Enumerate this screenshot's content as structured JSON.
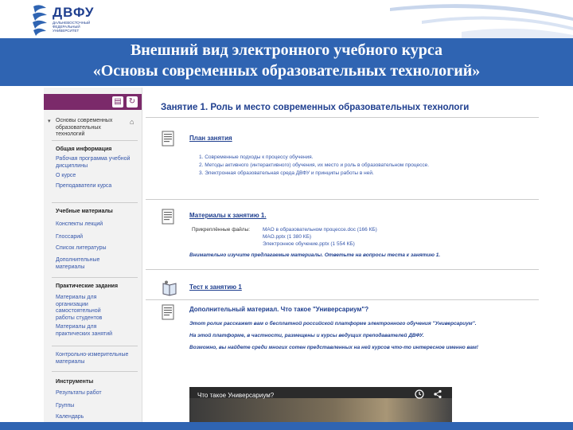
{
  "logo": {
    "text": "ДВФУ",
    "sub": "ДАЛЬНЕВОСТОЧНЫЙ ФЕДЕРАЛЬНЫЙ УНИВЕРСИТЕТ"
  },
  "slide": {
    "title_line1": "Внешний вид электронного учебного курса",
    "title_line2": "«Основы современных образовательных технологий»"
  },
  "sidebar": {
    "course_title": "Основы современных образовательных технологий",
    "sections": [
      {
        "title": "Общая информация",
        "items": [
          "Рабочая программа учебной дисциплины",
          "О курсе",
          "Преподаватели курса"
        ]
      },
      {
        "title": "Учебные материалы",
        "items": [
          "Конспекты лекций",
          "Глоссарий",
          "Список литературы",
          "Дополнительные материалы"
        ]
      },
      {
        "title": "Практические задания",
        "items": [
          "Материалы для организации самостоятельной работы студентов",
          "Материалы для практических занятий"
        ]
      },
      {
        "title": "",
        "items": [
          "Контрольно-измерительные материалы"
        ]
      },
      {
        "title": "Инструменты",
        "items": [
          "Результаты работ",
          "Группы",
          "Календарь"
        ]
      }
    ]
  },
  "main": {
    "title": "Занятие 1. Роль и место современных образовательных технологи",
    "blocks": [
      {
        "title": "План занятия",
        "lines": [
          "1.  Современные подходы к процессу обучения.",
          "2.  Методы активного (интерактивного) обучения, их место и роль в образовательном процессе.",
          "3.  Электронная образовательная среда ДВФУ и принципы работы в ней."
        ]
      },
      {
        "title": "Материалы к занятию 1.",
        "label": "Прикреплённые файлы:",
        "files": [
          "МАО в образовательном процессе.doc (166 КБ)",
          "МАО.pptx (1 380 КБ)",
          "Электронное обучение.pptx (1 554 КБ)"
        ],
        "note": "Внимательно изучите предлагаемые материалы. Ответьте на вопросы теста к занятию 1."
      },
      {
        "title": "Тест к занятию 1"
      },
      {
        "title": "Дополнительный материал. Что такое \"Универсариум\"?",
        "notes": [
          "Этот ролик расскажет вам о бесплатной российской платформе электронного обучения \"Универсариум\".",
          "На этой платформе, в частности, размещены и курсы ведущих преподавателей ДВФУ.",
          "Возможно, вы найдете среди многих сотен представленных на ней курсов что-то интересное именно вам!"
        ],
        "video_title": "Что такое Универсариум?"
      }
    ]
  },
  "colors": {
    "accent": "#2f64b2",
    "sidebar_header": "#7b2a6a",
    "link": "#3355aa",
    "title": "#1f3f8f"
  },
  "icons": {
    "logo": "dvfu-logo-icon",
    "doc": "document-icon",
    "test": "test-icon",
    "home": "home-icon",
    "clock": "clock-icon",
    "share": "share-icon"
  }
}
